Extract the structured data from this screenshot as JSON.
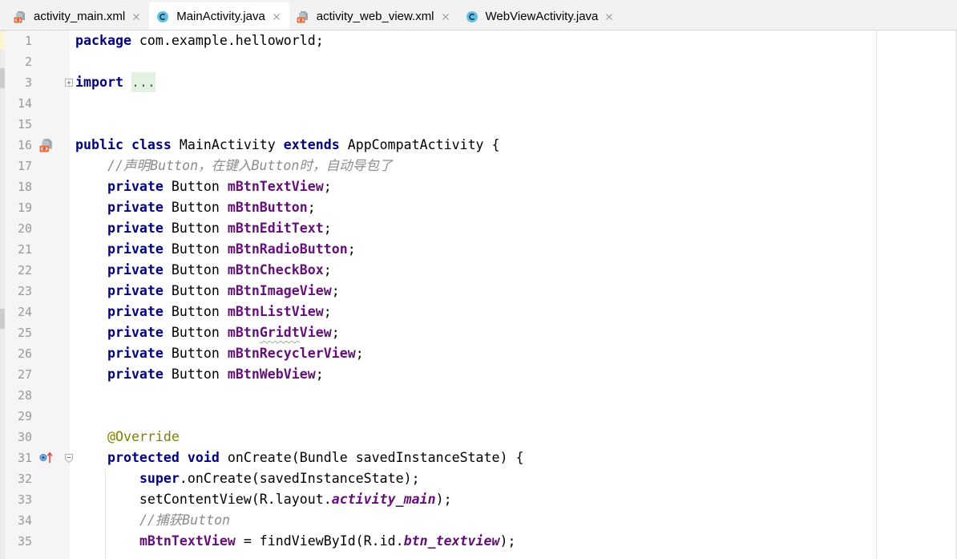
{
  "tabs": [
    {
      "label": "activity_main.xml",
      "icon": "xml-file-icon",
      "active": false
    },
    {
      "label": "MainActivity.java",
      "icon": "java-class-icon",
      "active": true
    },
    {
      "label": "activity_web_view.xml",
      "icon": "xml-file-icon",
      "active": false
    },
    {
      "label": "WebViewActivity.java",
      "icon": "java-class-icon",
      "active": false
    }
  ],
  "colors": {
    "keyword": "#000080",
    "field": "#660e7a",
    "comment": "#8c8c8c",
    "annotation": "#808000",
    "text": "#000000",
    "line_number": "#999999",
    "fold_placeholder_bg": "#e3f1e3"
  },
  "editor": {
    "lines": [
      {
        "number": "1",
        "tokens": [
          {
            "k": "kw",
            "t": "package"
          },
          {
            "k": "txt",
            "t": " com.example.helloworld;"
          }
        ]
      },
      {
        "number": "2",
        "tokens": []
      },
      {
        "number": "3",
        "fold_icon": "fold-expand-icon",
        "tokens": [
          {
            "k": "kw",
            "t": "import"
          },
          {
            "k": "txt",
            "t": " "
          },
          {
            "k": "fold",
            "t": "..."
          }
        ]
      },
      {
        "number": "14",
        "tokens": []
      },
      {
        "number": "15",
        "tokens": []
      },
      {
        "number": "16",
        "gutter_icon": "layout-file-link-icon",
        "tokens": [
          {
            "k": "kw",
            "t": "public"
          },
          {
            "k": "txt",
            "t": " "
          },
          {
            "k": "kw",
            "t": "class"
          },
          {
            "k": "txt",
            "t": " MainActivity "
          },
          {
            "k": "kw",
            "t": "extends"
          },
          {
            "k": "txt",
            "t": " AppCompatActivity {"
          }
        ]
      },
      {
        "number": "17",
        "tokens": [
          {
            "k": "txt",
            "t": "    "
          },
          {
            "k": "cmt",
            "t": "//声明Button，在键入Button时，自动导包了"
          }
        ]
      },
      {
        "number": "18",
        "tokens": [
          {
            "k": "txt",
            "t": "    "
          },
          {
            "k": "kw",
            "t": "private"
          },
          {
            "k": "txt",
            "t": " Button "
          },
          {
            "k": "fld",
            "t": "mBtnTextView"
          },
          {
            "k": "txt",
            "t": ";"
          }
        ]
      },
      {
        "number": "19",
        "tokens": [
          {
            "k": "txt",
            "t": "    "
          },
          {
            "k": "kw",
            "t": "private"
          },
          {
            "k": "txt",
            "t": " Button "
          },
          {
            "k": "fld",
            "t": "mBtnButton"
          },
          {
            "k": "txt",
            "t": ";"
          }
        ]
      },
      {
        "number": "20",
        "tokens": [
          {
            "k": "txt",
            "t": "    "
          },
          {
            "k": "kw",
            "t": "private"
          },
          {
            "k": "txt",
            "t": " Button "
          },
          {
            "k": "fld",
            "t": "mBtnEditText"
          },
          {
            "k": "txt",
            "t": ";"
          }
        ]
      },
      {
        "number": "21",
        "tokens": [
          {
            "k": "txt",
            "t": "    "
          },
          {
            "k": "kw",
            "t": "private"
          },
          {
            "k": "txt",
            "t": " Button "
          },
          {
            "k": "fld",
            "t": "mBtnRadioButton"
          },
          {
            "k": "txt",
            "t": ";"
          }
        ]
      },
      {
        "number": "22",
        "tokens": [
          {
            "k": "txt",
            "t": "    "
          },
          {
            "k": "kw",
            "t": "private"
          },
          {
            "k": "txt",
            "t": " Button "
          },
          {
            "k": "fld",
            "t": "mBtnCheckBox"
          },
          {
            "k": "txt",
            "t": ";"
          }
        ]
      },
      {
        "number": "23",
        "tokens": [
          {
            "k": "txt",
            "t": "    "
          },
          {
            "k": "kw",
            "t": "private"
          },
          {
            "k": "txt",
            "t": " Button "
          },
          {
            "k": "fld",
            "t": "mBtnImageView"
          },
          {
            "k": "txt",
            "t": ";"
          }
        ]
      },
      {
        "number": "24",
        "tokens": [
          {
            "k": "txt",
            "t": "    "
          },
          {
            "k": "kw",
            "t": "private"
          },
          {
            "k": "txt",
            "t": " Button "
          },
          {
            "k": "fld",
            "t": "mBtnListView"
          },
          {
            "k": "txt",
            "t": ";"
          }
        ]
      },
      {
        "number": "25",
        "tokens": [
          {
            "k": "txt",
            "t": "    "
          },
          {
            "k": "kw",
            "t": "private"
          },
          {
            "k": "txt",
            "t": " Button "
          },
          {
            "k": "fld",
            "t": "mBtn"
          },
          {
            "k": "fld typo",
            "t": "Gridt"
          },
          {
            "k": "fld",
            "t": "View"
          },
          {
            "k": "txt",
            "t": ";"
          }
        ]
      },
      {
        "number": "26",
        "tokens": [
          {
            "k": "txt",
            "t": "    "
          },
          {
            "k": "kw",
            "t": "private"
          },
          {
            "k": "txt",
            "t": " Button "
          },
          {
            "k": "fld",
            "t": "mBtnRecyclerView"
          },
          {
            "k": "txt",
            "t": ";"
          }
        ]
      },
      {
        "number": "27",
        "tokens": [
          {
            "k": "txt",
            "t": "    "
          },
          {
            "k": "kw",
            "t": "private"
          },
          {
            "k": "txt",
            "t": " Button "
          },
          {
            "k": "fld",
            "t": "mBtnWebView"
          },
          {
            "k": "txt",
            "t": ";"
          }
        ]
      },
      {
        "number": "28",
        "tokens": []
      },
      {
        "number": "29",
        "tokens": []
      },
      {
        "number": "30",
        "tokens": [
          {
            "k": "txt",
            "t": "    "
          },
          {
            "k": "ann",
            "t": "@Override"
          }
        ]
      },
      {
        "number": "31",
        "gutter_icon": "override-method-icon",
        "fold_icon": "fold-collapse-icon",
        "tokens": [
          {
            "k": "txt",
            "t": "    "
          },
          {
            "k": "kw",
            "t": "protected"
          },
          {
            "k": "txt",
            "t": " "
          },
          {
            "k": "kw",
            "t": "void"
          },
          {
            "k": "txt",
            "t": " onCreate(Bundle savedInstanceState) {"
          }
        ]
      },
      {
        "number": "32",
        "tokens": [
          {
            "k": "txt",
            "t": "        "
          },
          {
            "k": "kw",
            "t": "super"
          },
          {
            "k": "txt",
            "t": ".onCreate(savedInstanceState);"
          }
        ]
      },
      {
        "number": "33",
        "tokens": [
          {
            "k": "txt",
            "t": "        setContentView(R.layout."
          },
          {
            "k": "sfld",
            "t": "activity_main"
          },
          {
            "k": "txt",
            "t": ");"
          }
        ]
      },
      {
        "number": "34",
        "tokens": [
          {
            "k": "txt",
            "t": "        "
          },
          {
            "k": "cmt",
            "t": "//捕获Button"
          }
        ]
      },
      {
        "number": "35",
        "tokens": [
          {
            "k": "txt",
            "t": "        "
          },
          {
            "k": "fld",
            "t": "mBtnTextView"
          },
          {
            "k": "txt",
            "t": " = findViewById(R.id."
          },
          {
            "k": "sfld",
            "t": "btn_textview"
          },
          {
            "k": "txt",
            "t": ");"
          }
        ]
      }
    ]
  }
}
